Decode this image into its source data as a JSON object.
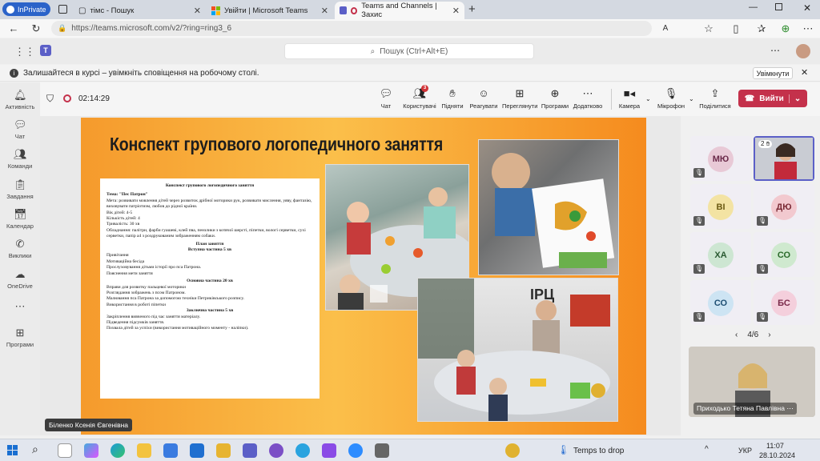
{
  "browser": {
    "inprivate": "InPrivate",
    "tabs": [
      {
        "title": "тімс - Пошук"
      },
      {
        "title": "Увійти | Microsoft Teams"
      },
      {
        "title": "Teams and Channels | Захис"
      }
    ],
    "url": "https://teams.microsoft.com/v2/?ring=ring3_6"
  },
  "teams": {
    "search_placeholder": "Пошук (Ctrl+Alt+E)",
    "banner_text": "Залишайтеся в курсі – увімкніть сповіщення на робочому столі.",
    "banner_button": "Увімкнути",
    "rail": [
      "Активність",
      "Чат",
      "Команди",
      "Завдання",
      "Календар",
      "Виклики",
      "OneDrive",
      "Програми"
    ]
  },
  "meeting": {
    "timer": "02:14:29",
    "tools": [
      "Чат",
      "Користувачі",
      "Підняти",
      "Реагувати",
      "Переглянути",
      "Програми",
      "Додатково",
      "Камера",
      "Мікрофон",
      "Поділитися"
    ],
    "people_badge": "3",
    "leave": "Вийти",
    "pager": "4/6",
    "participants": [
      {
        "initials": "МЮ",
        "color": "#e8c9d6",
        "fg": "#6b2a4a"
      },
      {
        "initials": "ВІ",
        "color": "#f3e3a3",
        "fg": "#6b5a12"
      },
      {
        "initials": "ДЮ",
        "color": "#f2c9cf",
        "fg": "#7a2a35"
      },
      {
        "initials": "ХА",
        "color": "#cde6d2",
        "fg": "#2a5a32"
      },
      {
        "initials": "СО",
        "color": "#cfe9cf",
        "fg": "#2a6a2a"
      },
      {
        "initials": "СО",
        "color": "#cde4f3",
        "fg": "#1e4f73"
      },
      {
        "initials": "БС",
        "color": "#f4cfdc",
        "fg": "#7a2a4a"
      }
    ],
    "video_badge": "2",
    "self_name": "Приходько Тетяна Павлівна",
    "speaker_name": "Біленко Ксенія Євгенівна"
  },
  "slide": {
    "title": "Конспект групового логопедичного заняття",
    "doc_heading": "Конспект групового логопедичного заняття",
    "topic": "Тема:          \"Пес Патрон\"",
    "lines": [
      "Мета: розвивати мовлення дітей через розвиток дрібної моторики рук, розвивати мислення, уяву, фантазію, виховувати патріотизм, любов до рідної країни.",
      "Вік дітей: 4-5",
      "Кількість дітей: 4",
      "Тривалість: 30 хв",
      "Обладнання: палітри, фарби гуашеві, клей пва, пензлики з котячої шерсті, піпетки, вологі серветки, сухі серветки, папір а4 з роздрукованим зображенням собаки."
    ],
    "plan_heading": "План заняття",
    "part1_heading": "Вступна частина 5 хв",
    "part1": [
      "Привітання",
      "Мотиваційна бесіда",
      "Прослуховування дітьми історії про пса Патрона.",
      "Пояснення мети заняття"
    ],
    "part2_heading": "Основна частина 20 хв",
    "part2": [
      "Вправи для розвитку пальцевої моторики",
      "Розглядання зображень з псом Патроном.",
      "Малювання пса Патрона за допомогою техніки Петриківського розпису.",
      "Використання в роботі піпетки"
    ],
    "part3_heading": "Заключна частина 5 хв",
    "part3": [
      "Закріплення вивченого під час заняття матеріалу.",
      "Підведення підсумків заняття.",
      "Похвала дітей за успіхи (використання мотиваційного моменту - наліпки)."
    ],
    "photo_sign": "ІРЦ"
  },
  "taskbar": {
    "weather": "Temps to drop",
    "lang": "УКР",
    "time": "11:07",
    "date": "28.10.2024"
  }
}
